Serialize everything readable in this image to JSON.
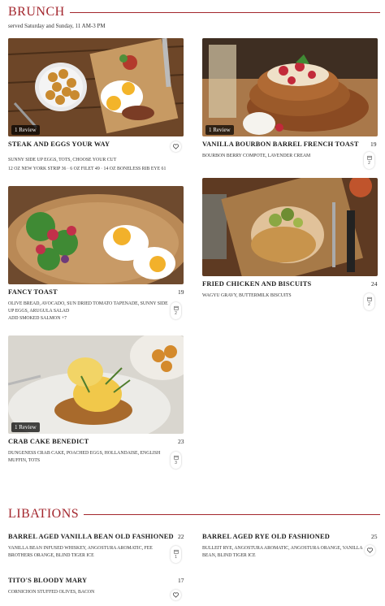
{
  "brunch": {
    "title": "BRUNCH",
    "subtitle": "served Saturday and Sunday, 11 AM-3 PM",
    "items": [
      {
        "name": "STEAK AND EGGS YOUR WAY",
        "price": "",
        "desc": "SUNNY SIDE UP EGGS, TOTS, CHOOSE YOUR CUT",
        "desc2": "12 OZ NEW YORK STRIP 36 · 6 OZ FILET 49 · 14 OZ BONELESS RIB EYE 61",
        "review": "1 Review",
        "fav_count": ""
      },
      {
        "name": "VANILLA BOURBON BARREL FRENCH TOAST",
        "price": "19",
        "desc": "BOURBON BERRY COMPOTE, LAVENDER CREAM",
        "desc2": "",
        "review": "1 Review",
        "fav_count": "2"
      },
      {
        "name": "FANCY TOAST",
        "price": "19",
        "desc": "OLIVE BREAD, AVOCADO, SUN DRIED TOMATO TAPENADE, SUNNY SIDE UP EGGS, ARUGULA SALAD",
        "desc2": "ADD SMOKED SALMON +7",
        "review": "",
        "fav_count": "2"
      },
      {
        "name": "FRIED CHICKEN AND BISCUITS",
        "price": "24",
        "desc": "WAGYU GRAVY, BUTTERMILK BISCUITS",
        "desc2": "",
        "review": "",
        "fav_count": "2"
      },
      {
        "name": "CRAB CAKE BENEDICT",
        "price": "23",
        "desc": "DUNGENESS CRAB CAKE, POACHED EGGS, HOLLANDAISE, ENGLISH MUFFIN, TOTS",
        "desc2": "",
        "review": "1 Review",
        "fav_count": "3"
      }
    ]
  },
  "libations": {
    "title": "LIBATIONS",
    "items": [
      {
        "name": "BARREL AGED VANILLA BEAN OLD FASHIONED",
        "price": "22",
        "desc": "VANILLA BEAN INFUSED WHISKEY, ANGOSTURA AROMATIC, FEE BROTHERS ORANGE, BLIND TIGER ICE",
        "fav_count": "1"
      },
      {
        "name": "BARREL AGED RYE OLD FASHIONED",
        "price": "25",
        "desc": "BULLEIT RYE, ANGOSTURA AROMATIC, ANGOSTURA ORANGE, VANILLA BEAN, BLIND TIGER ICE",
        "fav_count": ""
      },
      {
        "name": "TITO'S BLOODY MARY",
        "price": "17",
        "desc": "CORNICHON STUFFED OLIVES, BACON",
        "fav_count": ""
      }
    ]
  },
  "icons": {
    "favorite": "heart-icon",
    "calendar": "calendar-icon"
  },
  "colors": {
    "accent": "#a3262d"
  }
}
